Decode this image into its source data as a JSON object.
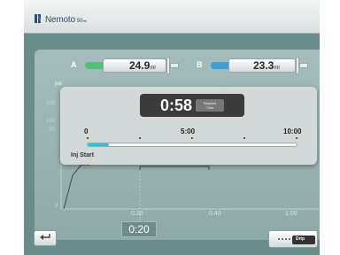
{
  "app": {
    "brand": "Nemoto",
    "brand_sub": "50ₘₗ"
  },
  "syringes": [
    {
      "letter": "A",
      "value": "24.9",
      "unit": "ml",
      "color": "#4fbf7a"
    },
    {
      "letter": "B",
      "value": "23.3",
      "unit": "ml",
      "color": "#3f9ed8"
    }
  ],
  "chart": {
    "y_unit": "psi",
    "y_ticks": [
      "200",
      "100",
      "50",
      "0"
    ],
    "x_ticks": [
      "0:20",
      "0:40",
      "1:00"
    ],
    "current_time": "0:20"
  },
  "overlay": {
    "elapsed": "0:58",
    "elapsed_label_1": "Elapsed",
    "elapsed_label_2": "Time",
    "timeline_labels": [
      "0",
      "5:00",
      "10:00"
    ],
    "progress_fraction": 0.1,
    "inj_start_label": "Inj Start",
    "progress_color": "#3bbcd9"
  },
  "buttons": {
    "back_icon": "return-arrow-icon",
    "drip_label": "Drip"
  }
}
